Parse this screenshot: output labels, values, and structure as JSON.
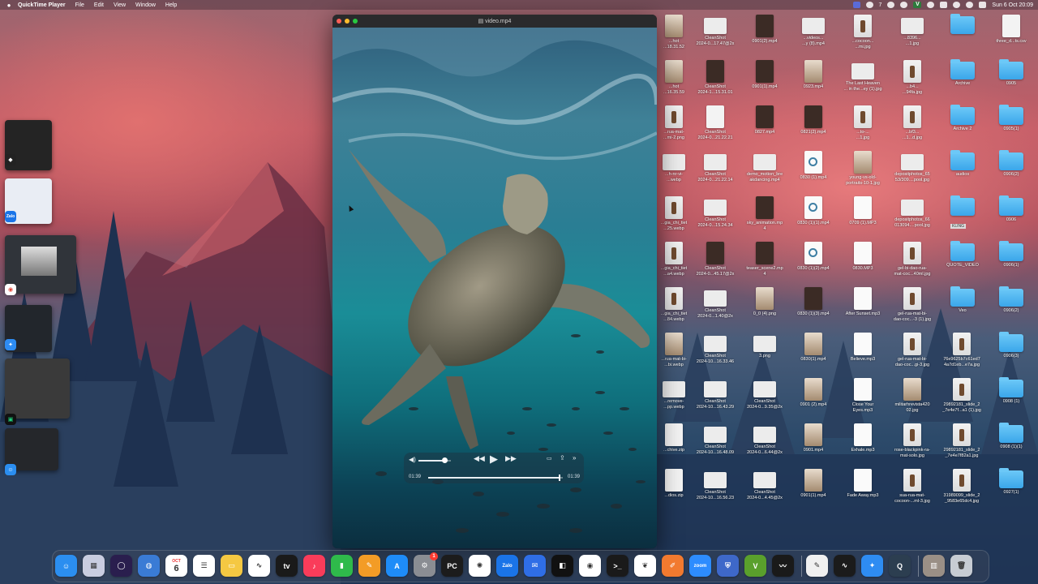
{
  "menubar": {
    "app_name": "QuickTime Player",
    "menus": [
      "File",
      "Edit",
      "View",
      "Window",
      "Help"
    ],
    "status_icons": [
      "display-icon",
      "notification-icon",
      "dropbox-icon",
      "record-icon",
      "bluetooth-icon",
      "wifi-icon",
      "search-icon",
      "control-center-icon"
    ],
    "badge_number": "7",
    "vpn_label": "V",
    "datetime": "Sun 6 Oct  20:09"
  },
  "player": {
    "title": "video.mp4",
    "time_elapsed": "01:39",
    "time_remaining": "01:39",
    "volume_level": 0.8,
    "progress": 0.97
  },
  "stage_manager": {
    "apps": [
      "Cursor",
      "Zalo",
      "Chrome",
      "Safari",
      "PyCharm",
      "Finder"
    ],
    "labels": [
      "Zalo"
    ]
  },
  "desktop": {
    "columns": [
      {
        "items": [
          {
            "label": "...hot\n...18.31.52",
            "kind": "photo"
          },
          {
            "label": "...hot\n...16.35.59",
            "kind": "photo"
          },
          {
            "label": "...rua-mat-\n...mi-2.png",
            "kind": "bottle"
          },
          {
            "label": "...h-nr-vi-\n...webp",
            "kind": "wide"
          },
          {
            "label": "...gia_chi_tiet\n...25.webp",
            "kind": "bottle"
          },
          {
            "label": "...gia_chi_tiet\n...a4.webp",
            "kind": "bottle"
          },
          {
            "label": "...gia_chi_tiet\n...84.webp",
            "kind": "bottle"
          },
          {
            "label": "...rua-mat-bi-\n...bi.webp",
            "kind": "photo"
          },
          {
            "label": "...remove-\n...pp.webp",
            "kind": "wide"
          },
          {
            "label": "...chive.zip",
            "kind": "file"
          },
          {
            "label": "...dios.zip",
            "kind": "file"
          }
        ]
      },
      {
        "items": [
          {
            "label": "CleanShot\n2024-0...17.47@2x",
            "kind": "wide"
          },
          {
            "label": "CleanShot\n2024-1...15.31.01",
            "kind": "dark"
          },
          {
            "label": "CleanShot\n2024-0...21.22.21",
            "kind": "file"
          },
          {
            "label": "CleanShot\n2024-0...21.22.14",
            "kind": "wide"
          },
          {
            "label": "CleanShot\n2024-0...15.24.34",
            "kind": "wide"
          },
          {
            "label": "CleanShot\n2024-0...45.17@2x",
            "kind": "dark"
          },
          {
            "label": "CleanShot\n2024-0...1.40@2x",
            "kind": "wide"
          },
          {
            "label": "CleanShot\n2024-10...16.33.46",
            "kind": "wide"
          },
          {
            "label": "CleanShot\n2024-10...16.43.29",
            "kind": "wide"
          },
          {
            "label": "CleanShot\n2024-10...16.48.09",
            "kind": "wide"
          },
          {
            "label": "CleanShot\n2024-10...16.56.23",
            "kind": "wide"
          }
        ]
      },
      {
        "items": [
          {
            "label": "0901(2).mp4",
            "kind": "dark"
          },
          {
            "label": "0901(1).mp4",
            "kind": "dark"
          },
          {
            "label": "0827.mp4",
            "kind": "dark"
          },
          {
            "label": "demo_motion_bre\nakdancing.mp4",
            "kind": "wide"
          },
          {
            "label": "sky_animation.mp\n4",
            "kind": "dark"
          },
          {
            "label": "teaser_scene2.mp\n4",
            "kind": "dark"
          },
          {
            "label": "0_0 (4).png",
            "kind": "photo"
          },
          {
            "label": "3.png",
            "kind": "wide"
          },
          {
            "label": "CleanShot\n2024-0...9.35@2x",
            "kind": "wide"
          },
          {
            "label": "CleanShot\n2024-0...6.44@2x",
            "kind": "wide"
          },
          {
            "label": "CleanShot\n2024-0...4.45@2x",
            "kind": "wide"
          }
        ]
      },
      {
        "items": [
          {
            "label": "...videos...\n...y (8).mp4",
            "kind": "wide"
          },
          {
            "label": "0923.mp4",
            "kind": "photo"
          },
          {
            "label": "0821(2).mp4",
            "kind": "dark"
          },
          {
            "label": "0830 (1).mp4",
            "kind": "qt"
          },
          {
            "label": "0830 (1)(1).mp4",
            "kind": "qt"
          },
          {
            "label": "0830 (1)(2).mp4",
            "kind": "qt"
          },
          {
            "label": "0830 (1)(3).mp4",
            "kind": "dark"
          },
          {
            "label": "0830(1).mp4",
            "kind": "photo"
          },
          {
            "label": "0901 (2).mp4",
            "kind": "photo"
          },
          {
            "label": "0901.mp4",
            "kind": "photo"
          },
          {
            "label": "0901(1).mp4",
            "kind": "photo"
          }
        ]
      },
      {
        "items": [
          {
            "label": "...cocoon...\n...mi.jpg",
            "kind": "bottle"
          },
          {
            "label": "The Last Heaven\n... in the...ey (1).jpg",
            "kind": "wide"
          },
          {
            "label": "...to-...\n...1.jpg",
            "kind": "bottle"
          },
          {
            "label": "young-vs-old-\nportraits-10-1.jpg",
            "kind": "photo"
          },
          {
            "label": "0709 (1).MP3",
            "kind": "audio"
          },
          {
            "label": "0830.MP3",
            "kind": "audio"
          },
          {
            "label": "After Sunset.mp3",
            "kind": "audio"
          },
          {
            "label": "Believe.mp3",
            "kind": "audio"
          },
          {
            "label": "Close Your\nEyes.mp3",
            "kind": "audio"
          },
          {
            "label": "Exhale.mp3",
            "kind": "audio"
          },
          {
            "label": "Fade Away.mp3",
            "kind": "audio"
          }
        ]
      },
      {
        "items": [
          {
            "label": "...8396...\n...1.jpg",
            "kind": "wide"
          },
          {
            "label": "...b4...\n...94fa.jpg",
            "kind": "bottle"
          },
          {
            "label": "...bf3...\n...1...d.jpg",
            "kind": "bottle"
          },
          {
            "label": "depositphotos_65\n53/309....pool.jpg",
            "kind": "wide"
          },
          {
            "label": "depositphotos_66\n013094....pool.jpg",
            "kind": "wide"
          },
          {
            "label": "gel-bi-dao-rua-\nmat-coc...40ml.jpg",
            "kind": "bottle"
          },
          {
            "label": "gel-rua-mat-bi-\ndao-coc...-3 (1).jpg",
            "kind": "bottle"
          },
          {
            "label": "gel-rua-mat-bi-\ndao-coc...gi-3.jpg",
            "kind": "bottle"
          },
          {
            "label": "militarhrevista420\n02.jpg",
            "kind": "photo"
          },
          {
            "label": "rose-blackpink-ra-\nmat-solo.jpg",
            "kind": "bottle"
          },
          {
            "label": "sua-rua-mat-\ncocoon-...ml-3.jpg",
            "kind": "bottle"
          }
        ]
      },
      {
        "items": [
          {
            "label": "",
            "kind": "none"
          },
          {
            "label": "",
            "kind": "none"
          },
          {
            "label": "",
            "kind": "none"
          },
          {
            "label": "",
            "kind": "none"
          },
          {
            "label": "",
            "kind": "none"
          },
          {
            "label": "",
            "kind": "none"
          },
          {
            "label": "",
            "kind": "none"
          },
          {
            "label": "76e9625b7c61ed7\n4a7d1eb...e7a.jpg",
            "kind": "bottle"
          },
          {
            "label": "29892181_slide_2\n_7e4e7f...a1 (1).jpg",
            "kind": "bottle"
          },
          {
            "label": "29892181_slide_2\n_7e4e7f82a1.jpg",
            "kind": "bottle"
          },
          {
            "label": "31989099_slide_2\n_9583e65dc4.jpg",
            "kind": "bottle"
          }
        ]
      },
      {
        "items": [
          {
            "label": "",
            "kind": "folder"
          },
          {
            "label": "Archive",
            "kind": "folder"
          },
          {
            "label": "Archive 2",
            "kind": "folder"
          },
          {
            "label": "audios",
            "kind": "folder"
          },
          {
            "label": "",
            "kind": "folder"
          },
          {
            "label": "QUOTE_VIDEO",
            "kind": "folder"
          },
          {
            "label": "Veo",
            "kind": "folder"
          },
          {
            "label": "",
            "kind": "none"
          },
          {
            "label": "",
            "kind": "none"
          },
          {
            "label": "",
            "kind": "none"
          },
          {
            "label": "",
            "kind": "none"
          }
        ]
      },
      {
        "items": [
          {
            "label": "three_d...ts.csv",
            "kind": "file"
          },
          {
            "label": "0905",
            "kind": "folder"
          },
          {
            "label": "0905(1)",
            "kind": "folder"
          },
          {
            "label": "0906(2)",
            "kind": "folder"
          },
          {
            "label": "0906",
            "kind": "folder"
          },
          {
            "label": "0906(1)",
            "kind": "folder"
          },
          {
            "label": "0906(2)",
            "kind": "folder"
          },
          {
            "label": "0906(3)",
            "kind": "folder"
          },
          {
            "label": "0908 (1)",
            "kind": "folder"
          },
          {
            "label": "0908 (1)(1)",
            "kind": "folder"
          },
          {
            "label": "0927(1)",
            "kind": "folder"
          }
        ]
      }
    ],
    "kling_label": "KLING"
  },
  "dock": {
    "apps": [
      {
        "name": "finder-icon",
        "glyph": "☺",
        "color": "#2b8ef0"
      },
      {
        "name": "launchpad-icon",
        "glyph": "▦",
        "color": "#c9cde0"
      },
      {
        "name": "arc-icon",
        "glyph": "◯",
        "color": "#2a1e4e"
      },
      {
        "name": "network-icon",
        "glyph": "◍",
        "color": "#3a7bd5"
      },
      {
        "name": "calendar-icon",
        "glyph": "6",
        "color": "#ffffff"
      },
      {
        "name": "reminders-icon",
        "glyph": "☰",
        "color": "#ffffff"
      },
      {
        "name": "notes-icon",
        "glyph": "▭",
        "color": "#f5c842"
      },
      {
        "name": "freeform-icon",
        "glyph": "∿",
        "color": "#ffffff"
      },
      {
        "name": "apple-tv-icon",
        "glyph": "tv",
        "color": "#1a1a1a"
      },
      {
        "name": "music-icon",
        "glyph": "♪",
        "color": "#fa3c5a"
      },
      {
        "name": "numbers-icon",
        "glyph": "▮",
        "color": "#2fba4b"
      },
      {
        "name": "pages-icon",
        "glyph": "✎",
        "color": "#f39c26"
      },
      {
        "name": "app-store-icon",
        "glyph": "A",
        "color": "#1e8cf8"
      },
      {
        "name": "system-settings-icon",
        "glyph": "⚙",
        "color": "#8a8d93"
      },
      {
        "name": "pycharm-icon",
        "glyph": "PC",
        "color": "#1c1c1c"
      },
      {
        "name": "chatgpt-icon",
        "glyph": "✺",
        "color": "#ffffff"
      },
      {
        "name": "zalo-icon",
        "glyph": "Zalo",
        "color": "#1a74e8"
      },
      {
        "name": "mail-icon",
        "glyph": "✉",
        "color": "#2f6ee6"
      },
      {
        "name": "capcut-icon",
        "glyph": "◧",
        "color": "#111111"
      },
      {
        "name": "chrome-icon",
        "glyph": "◉",
        "color": "#ffffff"
      },
      {
        "name": "terminal-icon",
        "glyph": ">_",
        "color": "#1a1a1a"
      },
      {
        "name": "mongodb-icon",
        "glyph": "❦",
        "color": "#ffffff"
      },
      {
        "name": "pencil-app-icon",
        "glyph": "✐",
        "color": "#f27a2f"
      },
      {
        "name": "zoom-icon",
        "glyph": "zoom",
        "color": "#2d8cff"
      },
      {
        "name": "shield-app-icon",
        "glyph": "⛨",
        "color": "#3e68c9"
      },
      {
        "name": "vim-icon",
        "glyph": "V",
        "color": "#5aa02c"
      },
      {
        "name": "voice-memos-icon",
        "glyph": "〰",
        "color": "#1a1a1a"
      }
    ],
    "recent": [
      {
        "name": "textedit-icon",
        "glyph": "✎",
        "color": "#f0f0f0"
      },
      {
        "name": "activity-monitor-icon",
        "glyph": "∿",
        "color": "#1b1b1b"
      },
      {
        "name": "safari-icon",
        "glyph": "✦",
        "color": "#2e8cf2"
      },
      {
        "name": "quicktime-icon",
        "glyph": "Q",
        "color": "#2c3e50"
      }
    ],
    "extras": [
      {
        "name": "downloads-stack-icon",
        "glyph": "▥",
        "color": "#9a8f86"
      },
      {
        "name": "trash-icon",
        "glyph": "🗑",
        "color": "#c7ccd3"
      }
    ],
    "settings_badge": "1",
    "calendar_month": "OCT"
  }
}
